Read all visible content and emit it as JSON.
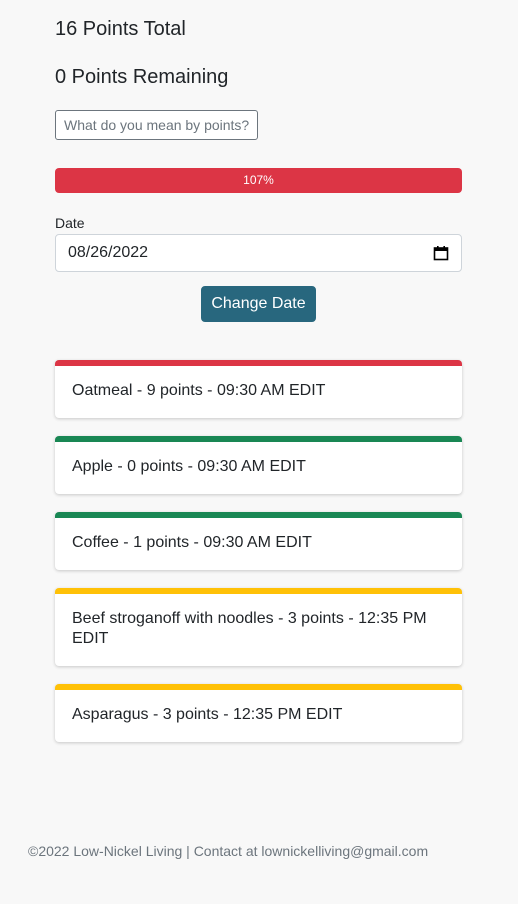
{
  "summary": {
    "total": "16 Points Total",
    "remaining": "0 Points Remaining",
    "help_button": "What do you mean by points?"
  },
  "progress": {
    "label": "107%",
    "percent": 107,
    "color": "#dc3545"
  },
  "date": {
    "label": "Date",
    "value": "08/26/2022",
    "button": "Change Date",
    "icon": "calendar-icon"
  },
  "entries": [
    {
      "text": "Oatmeal - 9 points - 09:30 AM",
      "edit": "EDIT",
      "color": "#dc3545"
    },
    {
      "text": "Apple - 0 points - 09:30 AM",
      "edit": "EDIT",
      "color": "#198754"
    },
    {
      "text": "Coffee - 1 points - 09:30 AM",
      "edit": "EDIT",
      "color": "#198754"
    },
    {
      "text": "Beef stroganoff with noodles - 3 points - 12:35 PM",
      "edit": "EDIT",
      "color": "#ffc107"
    },
    {
      "text": "Asparagus - 3 points - 12:35 PM",
      "edit": "EDIT",
      "color": "#ffc107"
    }
  ],
  "footer": {
    "text": "©2022 Low-Nickel Living | Contact at lownickelliving@gmail.com"
  }
}
